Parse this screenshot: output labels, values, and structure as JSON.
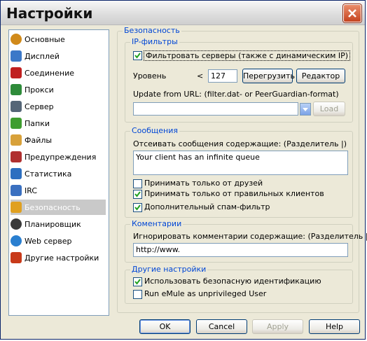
{
  "window": {
    "title": "Настройки"
  },
  "sidebar": {
    "items": [
      {
        "label": "Основные",
        "icon": "gear-icon",
        "color": "#d18a1a"
      },
      {
        "label": "Дисплей",
        "icon": "display-icon",
        "color": "#3b78c8"
      },
      {
        "label": "Соединение",
        "icon": "network-icon",
        "color": "#c02020"
      },
      {
        "label": "Прокси",
        "icon": "proxy-icon",
        "color": "#2e8b3a"
      },
      {
        "label": "Сервер",
        "icon": "server-icon",
        "color": "#556677"
      },
      {
        "label": "Папки",
        "icon": "folder-icon",
        "color": "#3e9d2f"
      },
      {
        "label": "Файлы",
        "icon": "files-icon",
        "color": "#d8a13a"
      },
      {
        "label": "Предупреждения",
        "icon": "warning-icon",
        "color": "#b03030"
      },
      {
        "label": "Статистика",
        "icon": "statistics-icon",
        "color": "#2d6fc0"
      },
      {
        "label": "IRC",
        "icon": "irc-icon",
        "color": "#3a70c0"
      },
      {
        "label": "Безопасность",
        "icon": "lock-icon",
        "color": "#e0a020",
        "selected": true
      },
      {
        "label": "Планировщик",
        "icon": "clock-icon",
        "color": "#3a3a3a"
      },
      {
        "label": "Web сервер",
        "icon": "globe-icon",
        "color": "#2a7fd0"
      },
      {
        "label": "Другие настройки",
        "icon": "tools-icon",
        "color": "#c83a1a"
      }
    ]
  },
  "security": {
    "title": "Безопасность",
    "ipfilter": {
      "title": "IP-фильтры",
      "filter_label": "Фильтровать серверы (также с динамическим IP)",
      "filter_checked": true,
      "level_label": "Уровень",
      "level_op": "<",
      "level_value": "127",
      "reload_button": "Перегрузить",
      "editor_button": "Редактор",
      "update_label": "Update from URL: (filter.dat- or PeerGuardian-format)",
      "url_value": "",
      "load_button": "Load"
    },
    "messages": {
      "title": "Сообщения",
      "filter_label": "Отсеивать сообщения содержащие: (Разделитель |)",
      "filter_value": "Your client has an infinite queue",
      "friends_only_label": "Принимать только от друзей",
      "friends_only_checked": false,
      "valid_clients_label": "Принимать только от правильных клиентов",
      "valid_clients_checked": true,
      "spam_filter_label": "Дополнительный спам-фильтр",
      "spam_filter_checked": true
    },
    "comments": {
      "title": "Коментарии",
      "filter_label": "Игнорировать комментарии содержащие: (Разделитель |)",
      "filter_value": "http://www."
    },
    "other": {
      "title": "Другие настройки",
      "secure_id_label": "Использовать безопасную идентификацию",
      "secure_id_checked": true,
      "unprivileged_label": "Run eMule as unprivileged User",
      "unprivileged_checked": false
    }
  },
  "buttons": {
    "ok": "OK",
    "cancel": "Cancel",
    "apply": "Apply",
    "help": "Help"
  }
}
